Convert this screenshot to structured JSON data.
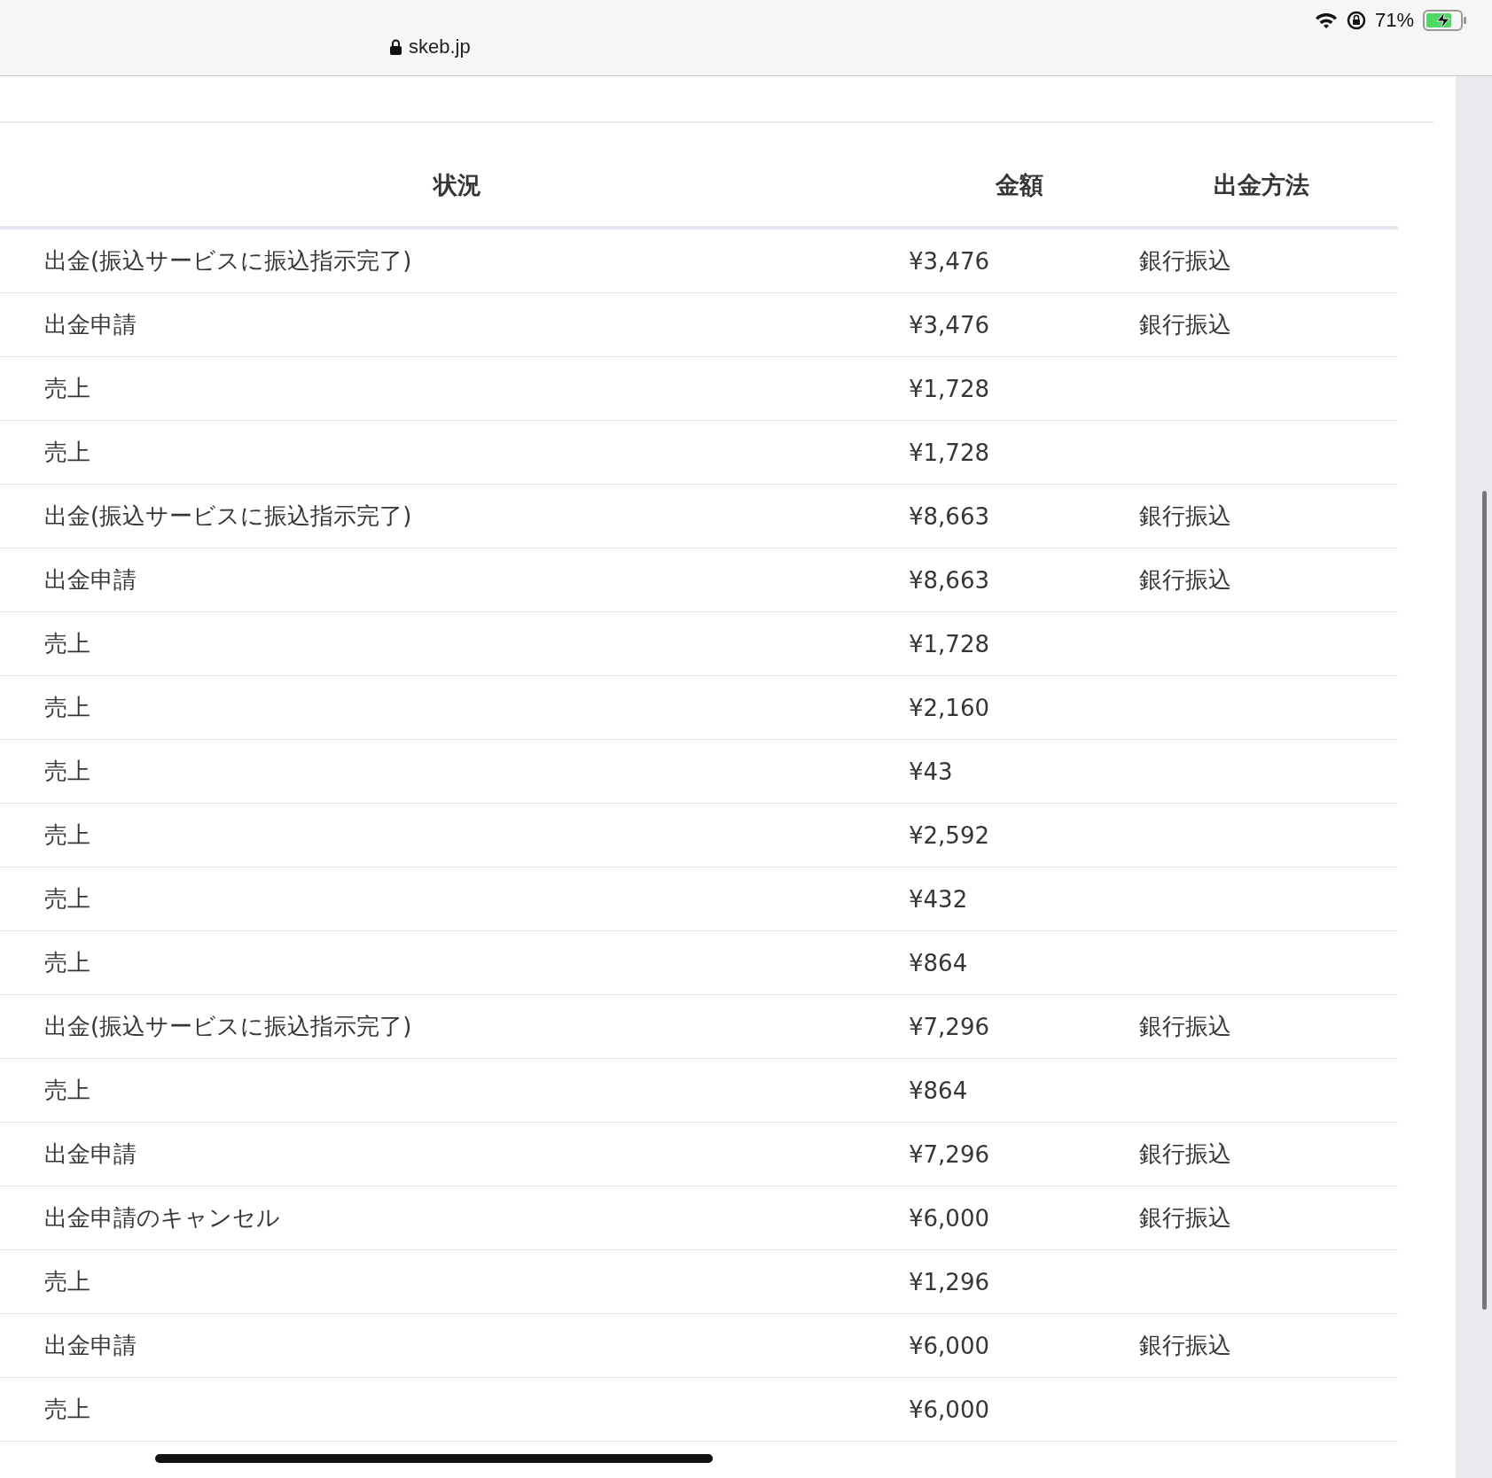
{
  "browser": {
    "url": "skeb.jp",
    "battery": "71%"
  },
  "table": {
    "columns": [
      "状況",
      "金額",
      "出金方法"
    ],
    "rows": [
      {
        "status": "出金(振込サービスに振込指示完了)",
        "amount": "¥3,476",
        "method": "銀行振込"
      },
      {
        "status": "出金申請",
        "amount": "¥3,476",
        "method": "銀行振込"
      },
      {
        "status": "売上",
        "amount": "¥1,728"
      },
      {
        "status": "売上",
        "amount": "¥1,728"
      },
      {
        "status": "出金(振込サービスに振込指示完了)",
        "amount": "¥8,663",
        "method": "銀行振込"
      },
      {
        "status": "出金申請",
        "amount": "¥8,663",
        "method": "銀行振込"
      },
      {
        "status": "売上",
        "amount": "¥1,728"
      },
      {
        "status": "売上",
        "amount": "¥2,160"
      },
      {
        "status": "売上",
        "amount": "¥43"
      },
      {
        "status": "売上",
        "amount": "¥2,592"
      },
      {
        "status": "売上",
        "amount": "¥432"
      },
      {
        "status": "売上",
        "amount": "¥864"
      },
      {
        "status": "出金(振込サービスに振込指示完了)",
        "amount": "¥7,296",
        "method": "銀行振込"
      },
      {
        "status": "売上",
        "amount": "¥864"
      },
      {
        "status": "出金申請",
        "amount": "¥7,296",
        "method": "銀行振込"
      },
      {
        "status": "出金申請のキャンセル",
        "amount": "¥6,000",
        "method": "銀行振込"
      },
      {
        "status": "売上",
        "amount": "¥1,296"
      },
      {
        "status": "出金申請",
        "amount": "¥6,000",
        "method": "銀行振込"
      },
      {
        "status": "売上",
        "amount": "¥6,000"
      }
    ]
  }
}
